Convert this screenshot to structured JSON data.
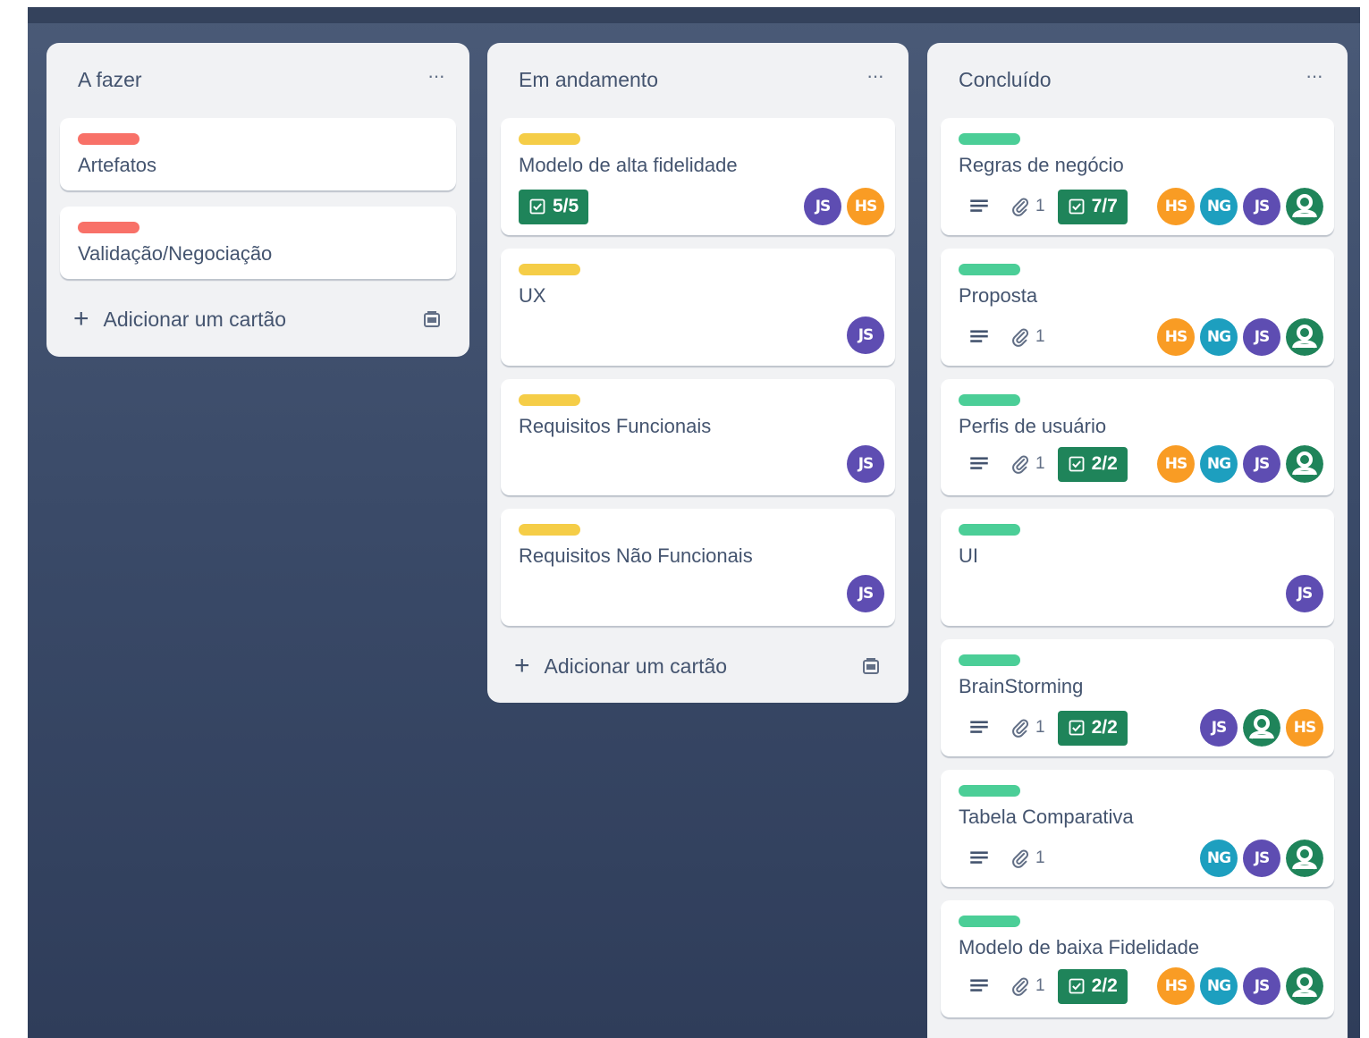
{
  "lists": [
    {
      "title": "A fazer",
      "menu": "···",
      "add_label": "Adicionar um cartão",
      "cards": [
        {
          "title": "Artefatos",
          "label_color": "red"
        },
        {
          "title": "Validação/Negociação",
          "label_color": "red"
        }
      ]
    },
    {
      "title": "Em andamento",
      "menu": "···",
      "add_label": "Adicionar um cartão",
      "cards": [
        {
          "title": "Modelo de alta fidelidade",
          "label_color": "yellow",
          "checklist": "5/5",
          "members": [
            "JS",
            "HS"
          ]
        },
        {
          "title": "UX",
          "label_color": "yellow",
          "members": [
            "JS"
          ]
        },
        {
          "title": "Requisitos Funcionais",
          "label_color": "yellow",
          "members": [
            "JS"
          ]
        },
        {
          "title": "Requisitos Não Funcionais",
          "label_color": "yellow",
          "members": [
            "JS"
          ]
        }
      ]
    },
    {
      "title": "Concluído",
      "menu": "···",
      "cards": [
        {
          "title": "Regras de negócio",
          "label_color": "green",
          "attachments": "1",
          "checklist": "7/7",
          "members": [
            "HS",
            "NG",
            "JS",
            "user"
          ]
        },
        {
          "title": "Proposta",
          "label_color": "green",
          "attachments": "1",
          "members": [
            "HS",
            "NG",
            "JS",
            "user"
          ]
        },
        {
          "title": "Perfis de usuário",
          "label_color": "green",
          "attachments": "1",
          "checklist": "2/2",
          "members": [
            "HS",
            "NG",
            "JS",
            "user"
          ]
        },
        {
          "title": "UI",
          "label_color": "green",
          "members": [
            "JS"
          ]
        },
        {
          "title": "BrainStorming",
          "label_color": "green",
          "attachments": "1",
          "checklist": "2/2",
          "members": [
            "JS",
            "user",
            "HS"
          ]
        },
        {
          "title": "Tabela Comparativa",
          "label_color": "green",
          "attachments": "1",
          "members": [
            "NG",
            "JS",
            "user"
          ]
        },
        {
          "title": "Modelo de baixa Fidelidade",
          "label_color": "green",
          "attachments": "1",
          "checklist": "2/2",
          "members": [
            "HS",
            "NG",
            "JS",
            "user"
          ]
        }
      ]
    }
  ],
  "colors": {
    "label_red": "#f87168",
    "label_yellow": "#f5cd47",
    "label_green": "#4bce97",
    "checklist_complete": "#1f845a",
    "avatar_js": "#5e4db2",
    "avatar_hs": "#f99c24",
    "avatar_ng": "#1d9fbf",
    "avatar_user": "#1f845a"
  }
}
